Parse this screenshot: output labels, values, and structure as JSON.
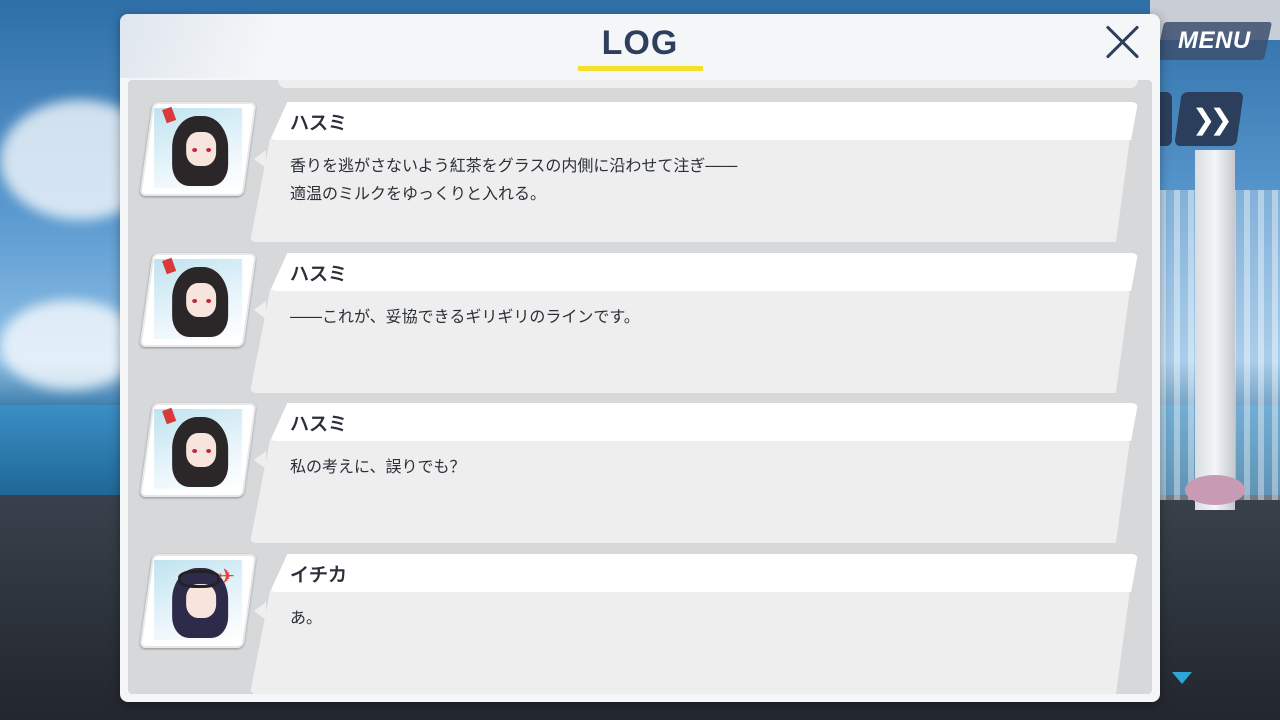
{
  "menu": {
    "label": "MENU"
  },
  "log": {
    "title": "LOG",
    "entries": [
      {
        "speaker": "ハスミ",
        "avatar_icon": "hasumi-portrait-icon",
        "text": "香りを逃がさないよう紅茶をグラスの内側に沿わせて注ぎ――\n適温のミルクをゆっくりと入れる。"
      },
      {
        "speaker": "ハスミ",
        "avatar_icon": "hasumi-portrait-icon",
        "text": "――これが、妥協できるギリギリのラインです。"
      },
      {
        "speaker": "ハスミ",
        "avatar_icon": "hasumi-portrait-icon",
        "text": "私の考えに、誤りでも？"
      },
      {
        "speaker": "イチカ",
        "avatar_icon": "ichika-portrait-icon",
        "text": "あ。"
      }
    ]
  },
  "colors": {
    "accent": "#f5e12a",
    "title": "#2d3f5c",
    "panel": "#d6d8da"
  }
}
